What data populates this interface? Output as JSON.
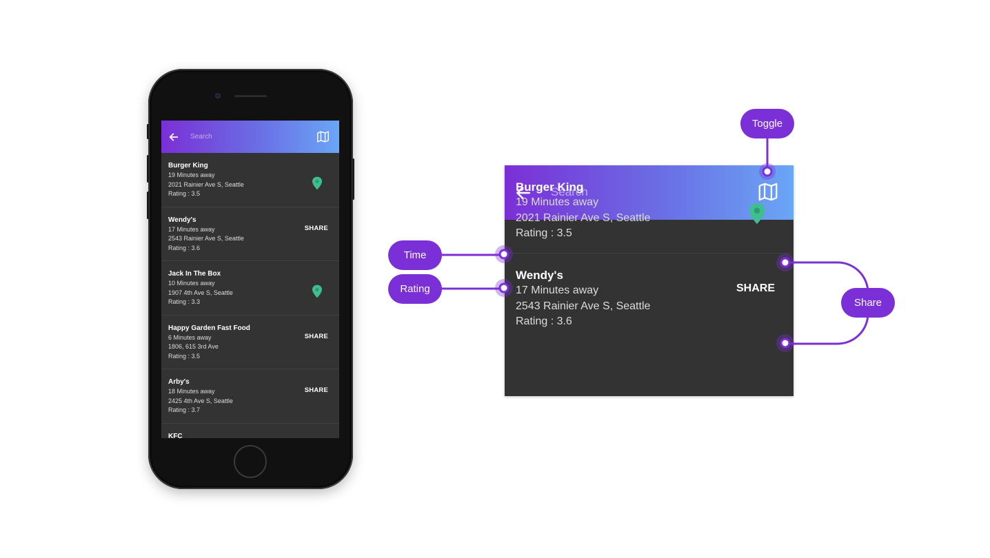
{
  "colors": {
    "accent": "#7b2fd6",
    "gradient_end": "#6aa6f6",
    "list_bg": "#333333",
    "pin": "#3fbf8f"
  },
  "app": {
    "search_placeholder": "Search",
    "icons": {
      "back": "arrow-left-icon",
      "toggle": "map-icon",
      "pin": "map-pin-icon"
    },
    "restaurants": [
      {
        "name": "Burger King",
        "time": "19 Minutes away",
        "address": "2021 Rainier Ave S, Seattle",
        "rating": "Rating : 3.5",
        "action": "pin"
      },
      {
        "name": "Wendy's",
        "time": "17 Minutes away",
        "address": "2543 Rainier Ave S, Seattle",
        "rating": "Rating : 3.6",
        "action": "share"
      },
      {
        "name": "Jack In The Box",
        "time": "10 Minutes away",
        "address": "1907 4th Ave S, Seattle",
        "rating": "Rating : 3.3",
        "action": "pin"
      },
      {
        "name": "Happy Garden Fast Food",
        "time": "6 Minutes away",
        "address": "1806, 615 3rd Ave",
        "rating": "Rating : 3.5",
        "action": "share"
      },
      {
        "name": "Arby's",
        "time": "18 Minutes away",
        "address": "2425 4th Ave S, Seattle",
        "rating": "Rating : 3.7",
        "action": "share"
      },
      {
        "name": "KFC"
      }
    ],
    "share_label": "SHARE"
  },
  "annotations": {
    "toggle": "Toggle",
    "time": "Time",
    "rating": "Rating",
    "share": "Share"
  }
}
